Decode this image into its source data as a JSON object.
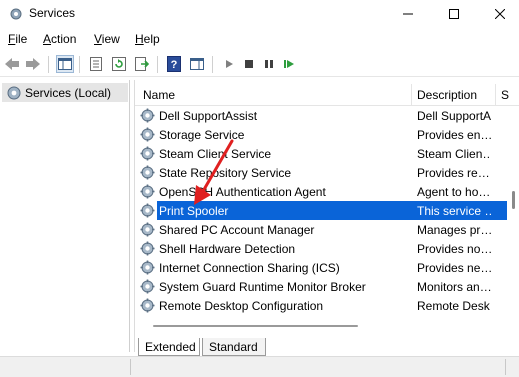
{
  "window": {
    "title": "Services",
    "minimize_glyph": "—",
    "maximize_glyph": "☐",
    "close_glyph": "✕"
  },
  "menu": [
    {
      "label": "File",
      "accel": "F",
      "rest": "ile"
    },
    {
      "label": "Action",
      "accel": "A",
      "rest": "ction"
    },
    {
      "label": "View",
      "accel": "V",
      "rest": "iew"
    },
    {
      "label": "Help",
      "accel": "H",
      "rest": "elp"
    }
  ],
  "toolbar": {
    "icons": [
      "back-icon",
      "forward-icon",
      "show-hide-console-tree-icon",
      "properties-icon",
      "refresh-icon",
      "export-list-icon",
      "help-icon",
      "show-hide-action-pane-icon",
      "start-service-icon",
      "stop-service-icon",
      "pause-service-icon",
      "restart-service-icon"
    ]
  },
  "tree": {
    "root_label": "Services (Local)"
  },
  "columns": {
    "name": "Name",
    "description": "Description",
    "partial": "S"
  },
  "services": [
    {
      "name": "Dell SupportAssist",
      "description": "Dell SupportA"
    },
    {
      "name": "Storage Service",
      "description": "Provides en…"
    },
    {
      "name": "Steam Client Service",
      "description": "Steam Clien…"
    },
    {
      "name": "State Repository Service",
      "description": "Provides re…"
    },
    {
      "name": "OpenSSH Authentication Agent",
      "description": "Agent to ho…"
    },
    {
      "name": "Print Spooler",
      "description": "This service …",
      "selected": true
    },
    {
      "name": "Shared PC Account Manager",
      "description": "Manages pr…"
    },
    {
      "name": "Shell Hardware Detection",
      "description": "Provides no…"
    },
    {
      "name": "Internet Connection Sharing (ICS)",
      "description": "Provides ne…"
    },
    {
      "name": "System Guard Runtime Monitor Broker",
      "description": "Monitors an…"
    },
    {
      "name": "Remote Desktop Configuration",
      "description": "Remote Desk…"
    }
  ],
  "tabs": {
    "extended": "Extended",
    "standard": "Standard"
  },
  "colors": {
    "selection": "#0a64d8",
    "arrow": "#e02020"
  }
}
